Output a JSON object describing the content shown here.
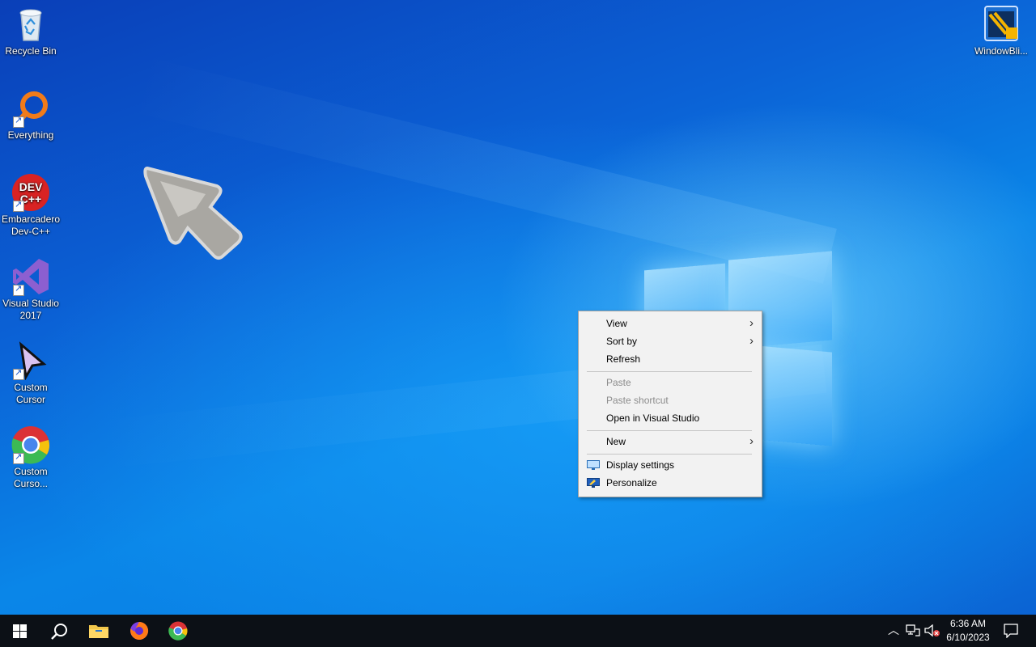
{
  "desktop": {
    "icons": [
      {
        "label": "Recycle Bin",
        "icon": "recycle-bin-icon"
      },
      {
        "label": "Everything",
        "icon": "everything-search-icon"
      },
      {
        "label": "Embarcadero Dev-C++",
        "icon": "devcpp-icon",
        "badge": "DEV C++"
      },
      {
        "label": "Visual Studio 2017",
        "icon": "visual-studio-icon"
      },
      {
        "label": "Custom Cursor",
        "icon": "custom-cursor-icon"
      },
      {
        "label": "Custom Curso...",
        "icon": "chrome-icon"
      },
      {
        "label": "WindowBli...",
        "icon": "windowblinds-icon"
      }
    ]
  },
  "context_menu": {
    "items": [
      {
        "label": "View",
        "submenu": true
      },
      {
        "label": "Sort by",
        "submenu": true
      },
      {
        "label": "Refresh"
      },
      {
        "label": "Paste",
        "disabled": true
      },
      {
        "label": "Paste shortcut",
        "disabled": true
      },
      {
        "label": "Open in Visual Studio"
      },
      {
        "label": "New",
        "submenu": true
      },
      {
        "label": "Display settings",
        "icon": "display-settings-icon"
      },
      {
        "label": "Personalize",
        "icon": "personalize-icon"
      }
    ]
  },
  "taskbar": {
    "buttons": [
      "start-icon",
      "search-icon",
      "file-explorer-icon",
      "firefox-icon",
      "chrome-icon"
    ],
    "tray": {
      "time": "6:36 AM",
      "date": "6/10/2023",
      "icons": [
        "chevron-up-icon",
        "network-icon",
        "volume-muted-icon",
        "notification-icon"
      ]
    }
  },
  "colors": {
    "taskbar": "#0c1016",
    "menu_bg": "#f2f2f2",
    "wallpaper": "#0b6cdc"
  }
}
